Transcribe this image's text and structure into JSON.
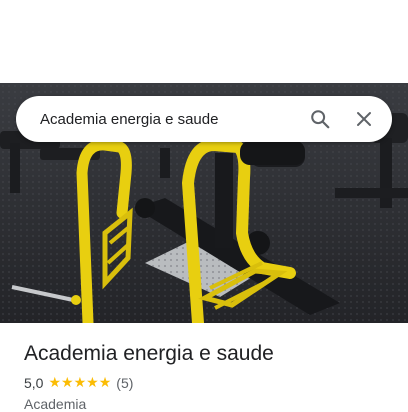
{
  "search": {
    "query": "Academia energia e saude",
    "search_icon": "search-icon",
    "close_icon": "close-icon"
  },
  "photo": {
    "subject": "gym-equipment-photo"
  },
  "place": {
    "name": "Academia energia e saude",
    "rating": "5,0",
    "stars": 5,
    "review_count": "(5)",
    "category": "Academia"
  },
  "colors": {
    "star": "#fbbc04",
    "title": "#202124",
    "secondary_text": "#5f6368",
    "equipment_yellow": "#e8cf10"
  }
}
